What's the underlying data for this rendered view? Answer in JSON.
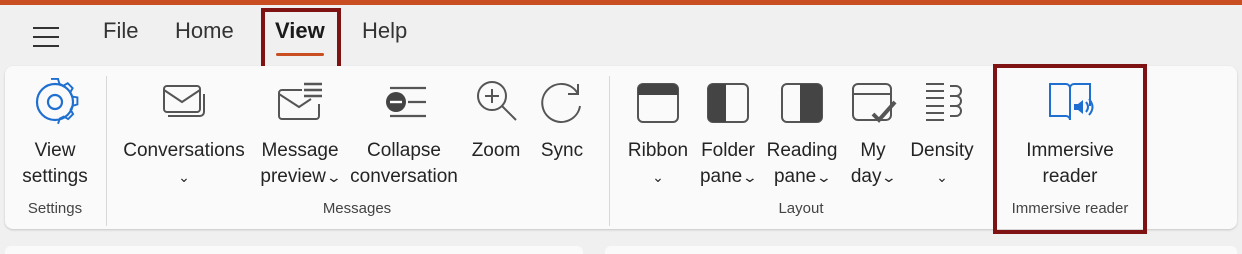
{
  "menubar": {
    "tabs": [
      {
        "label": "File"
      },
      {
        "label": "Home"
      },
      {
        "label": "View",
        "active": true
      },
      {
        "label": "Help"
      }
    ]
  },
  "ribbon": {
    "groups": {
      "settings": {
        "name": "Settings",
        "buttons": {
          "view_settings": {
            "line1": "View",
            "line2": "settings",
            "icon": "gear-icon"
          }
        }
      },
      "messages": {
        "name": "Messages",
        "buttons": {
          "conversations": {
            "line1": "Conversations",
            "icon": "envelope-stack-icon"
          },
          "message_preview": {
            "line1": "Message",
            "line2": "preview",
            "icon": "envelope-lines-icon"
          },
          "collapse_conversation": {
            "line1": "Collapse",
            "line2": "conversation",
            "icon": "collapse-list-icon"
          },
          "zoom": {
            "line1": "Zoom",
            "icon": "zoom-in-icon"
          },
          "sync": {
            "line1": "Sync",
            "icon": "refresh-icon"
          }
        }
      },
      "layout": {
        "name": "Layout",
        "buttons": {
          "ribbon": {
            "line1": "Ribbon",
            "icon": "ribbon-layout-icon"
          },
          "folder_pane": {
            "line1": "Folder",
            "line2": "pane",
            "icon": "folder-pane-icon"
          },
          "reading_pane": {
            "line1": "Reading",
            "line2": "pane",
            "icon": "reading-pane-icon"
          },
          "my_day": {
            "line1": "My",
            "line2": "day",
            "icon": "calendar-check-icon"
          },
          "density": {
            "line1": "Density",
            "icon": "density-icon"
          }
        }
      },
      "immersive_reader": {
        "name": "Immersive reader",
        "buttons": {
          "immersive_reader": {
            "line1": "Immersive",
            "line2": "reader",
            "icon": "book-speaker-icon"
          }
        }
      }
    }
  },
  "colors": {
    "accent": "#c94f23",
    "highlight_box": "#7f1212",
    "immersive_blue": "#1f6fd1"
  }
}
